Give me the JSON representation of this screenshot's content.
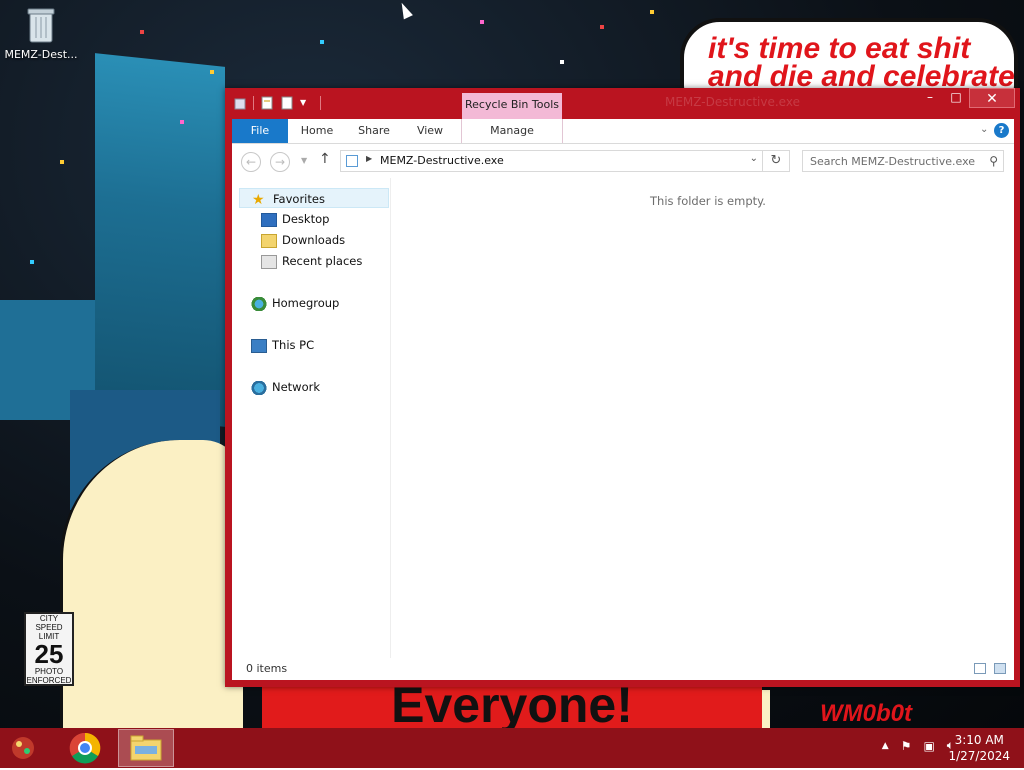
{
  "desktop": {
    "icons": [
      {
        "label": "MEMZ-Dest..."
      }
    ],
    "wallpaper_text": {
      "speech_line1": "it's time to eat shit",
      "speech_line2": "and die and celebrate",
      "banner": "Everyone!",
      "speed_sign_top": "CITY\nSPEED\nLIMIT",
      "speed_sign_num": "25",
      "speed_sign_bottom": "PHOTO\nENFORCED",
      "corner_tag": "WM0b0t"
    }
  },
  "window": {
    "title": "MEMZ-Destructive.exe",
    "context_tab": "Recycle Bin Tools",
    "ribbon_tabs": [
      "File",
      "Home",
      "Share",
      "View"
    ],
    "context_subtab": "Manage",
    "address_path": "MEMZ-Destructive.exe",
    "search_placeholder": "Search MEMZ-Destructive.exe",
    "nav": {
      "favorites": "Favorites",
      "favorites_items": [
        "Desktop",
        "Downloads",
        "Recent places"
      ],
      "homegroup": "Homegroup",
      "this_pc": "This PC",
      "network": "Network"
    },
    "empty_message": "This folder is empty.",
    "status": "0 items"
  },
  "taskbar": {
    "time": "3:10 AM",
    "date": "1/27/2024"
  },
  "colors": {
    "window_frame": "#ba1420",
    "taskbar": "#8f1119",
    "file_tab": "#1979ca",
    "context_tab": "#f3b9d6"
  }
}
